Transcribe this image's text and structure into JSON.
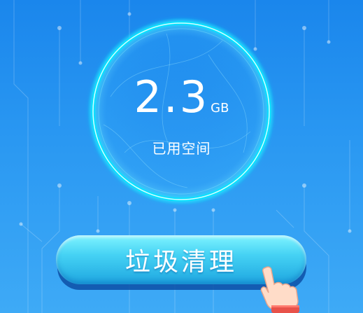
{
  "storage": {
    "used_value": "2.3",
    "used_unit": "GB",
    "used_label": "已用空间"
  },
  "actions": {
    "clean_label": "垃圾清理"
  },
  "colors": {
    "background_top": "#1a86ec",
    "background_bottom": "#3eaaf6",
    "ring_glow": "#00e5ff",
    "button_top": "#7ff4ff",
    "button_bottom": "#1ea6e0",
    "button_shadow": "#0d4fa6"
  },
  "icons": {
    "pointer": "hand-pointer-icon"
  }
}
